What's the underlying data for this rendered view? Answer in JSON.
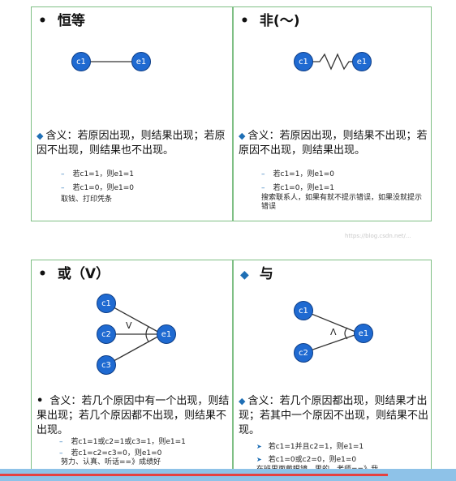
{
  "panels": [
    {
      "title_bullet": "•",
      "title": "恒等",
      "nodes": [
        "c1",
        "e1"
      ],
      "definition": "含义：若原因出现，则结果出现；若原因不出现，则结果也不出现。",
      "examples": [
        "若c1=1，则e1=1",
        "若c1=0，则e1=0"
      ],
      "note": "取钱、打印凭条"
    },
    {
      "title_bullet": "•",
      "title": "非(～)",
      "nodes": [
        "c1",
        "e1"
      ],
      "definition": "含义：若原因出现，则结果不出现；若原因不出现，则结果出现。",
      "examples": [
        "若c1=1，则e1=0",
        "若c1=0，则e1=1"
      ],
      "note": "搜索联系人，如果有就不提示错误，如果没就提示错误"
    },
    {
      "title_bullet": "•",
      "title": "或（V）",
      "nodes": [
        "c1",
        "c2",
        "c3",
        "e1"
      ],
      "symbol": "V",
      "definition": "含义：若几个原因中有一个出现，则结果出现；若几个原因都不出现，则结果不出现。",
      "examples": [
        "若c1=1或c2=1或c3=1，则e1=1",
        "若c1=c2=c3=0，则e1=0"
      ],
      "note": "努力、认真、听话==》成绩好"
    },
    {
      "title_bullet": "◆",
      "title": "与",
      "nodes": [
        "c1",
        "c2",
        "e1"
      ],
      "symbol": "Λ",
      "definition": "含义：若几个原因都出现，则结果才出现；若其中一个原因不出现，则结果不出现。",
      "examples": [
        "若c1=1并且c2=1，则e1=1",
        "若c1=0或c2=0，则e1=0"
      ],
      "note": "在班里面戴眼镜、男的、老师==》我"
    }
  ],
  "watermark": "https://blog.csdn.net/...",
  "progress": {
    "played_fraction": 0.85,
    "played_color": "#e64040",
    "track_color": "#8ec2e8"
  },
  "colors": {
    "panel_border": "#7fbf85",
    "node_fill": "#1f6ad1",
    "bullet_blue": "#1f6fb5"
  }
}
